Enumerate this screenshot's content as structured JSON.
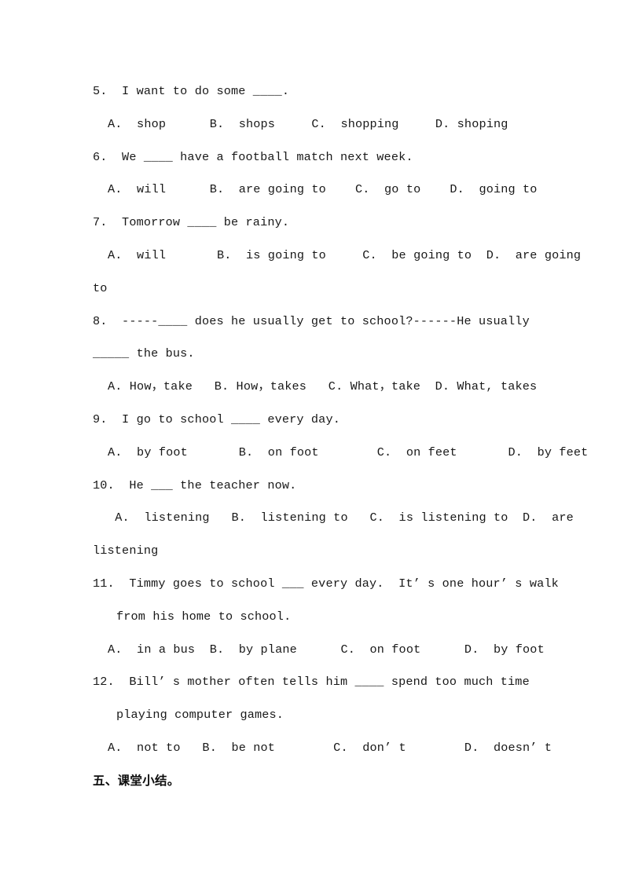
{
  "document": {
    "page_background": "#ffffff",
    "text_color": "#181818",
    "lines": [
      {
        "id": "q5_stem",
        "kind": "question",
        "text": "5.  I want to do some ____."
      },
      {
        "id": "q5_options",
        "kind": "options",
        "text": "A.  shop      B.  shops     C.  shopping     D. shoping"
      },
      {
        "id": "q6_stem",
        "kind": "question",
        "text": "6.  We ____ have a football match next week."
      },
      {
        "id": "q6_options",
        "kind": "options",
        "text": "A.  will      B.  are going to    C.  go to    D.  going to"
      },
      {
        "id": "q7_stem",
        "kind": "question",
        "text": "7.  Tomorrow ____ be rainy."
      },
      {
        "id": "q7_options",
        "kind": "options",
        "text": "A.  will       B.  is going to     C.  be going to  D.  are going"
      },
      {
        "id": "q7_tail",
        "kind": "tail",
        "text": "to"
      },
      {
        "id": "q8_stem",
        "kind": "question",
        "text": "8.  -----____ does he usually get to school?------He usually"
      },
      {
        "id": "q8_tail",
        "kind": "tail",
        "text": "_____ the bus."
      },
      {
        "id": "q8_options",
        "kind": "options",
        "text": "A. How，take   B. How，takes   C. What，take  D. What, takes"
      },
      {
        "id": "q9_stem",
        "kind": "question",
        "text": "9.  I go to school ____ every day."
      },
      {
        "id": "q9_options",
        "kind": "options",
        "text": "A.  by foot       B.  on foot        C.  on feet       D.  by feet"
      },
      {
        "id": "q10_stem",
        "kind": "question",
        "text": "10.  He ___ the teacher now."
      },
      {
        "id": "q10_options",
        "kind": "options",
        "text": " A.  listening   B.  listening to   C.  is listening to  D.  are"
      },
      {
        "id": "q10_tail",
        "kind": "tail",
        "text": "listening"
      },
      {
        "id": "q11_stem",
        "kind": "question",
        "text": "11.  Timmy goes to school ___ every day.  It’ s one hour’ s walk"
      },
      {
        "id": "q11_cont",
        "kind": "cont",
        "text": "from his home to school."
      },
      {
        "id": "q11_options",
        "kind": "options",
        "text": "A.  in a bus  B.  by plane      C.  on foot      D.  by foot"
      },
      {
        "id": "q12_stem",
        "kind": "question",
        "text": "12.  Bill’ s mother often tells him ____ spend too much time"
      },
      {
        "id": "q12_cont",
        "kind": "cont",
        "text": "playing computer games."
      },
      {
        "id": "q12_options",
        "kind": "options",
        "text": "A.  not to   B.  be not        C.  don’ t        D.  doesn’ t"
      }
    ],
    "section_heading": "五、课堂小结。"
  }
}
